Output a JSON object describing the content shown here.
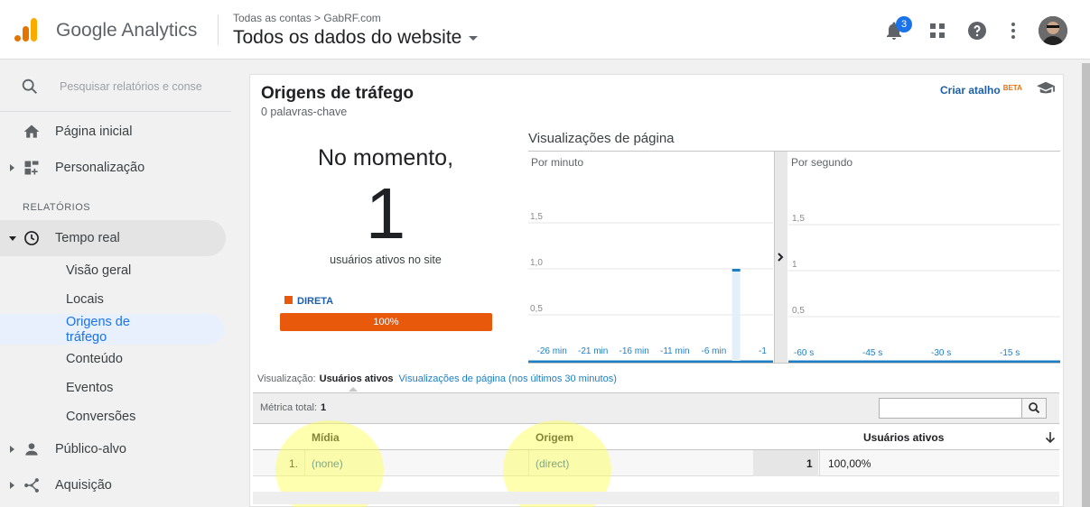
{
  "header": {
    "app_name": "Google Analytics",
    "breadcrumb": "Todas as contas > GabRF.com",
    "property": "Todos os dados do website",
    "notification_count": "3"
  },
  "sidebar": {
    "search_placeholder": "Pesquisar relatórios e conse",
    "home": "Página inicial",
    "customization": "Personalização",
    "section_reports": "RELATÓRIOS",
    "realtime": "Tempo real",
    "realtime_items": [
      "Visão geral",
      "Locais",
      "Origens de tráfego",
      "Conteúdo",
      "Eventos",
      "Conversões"
    ],
    "audience": "Público-alvo",
    "acquisition": "Aquisição"
  },
  "report": {
    "title": "Origens de tráfego",
    "subtitle": "0 palavras-chave",
    "shortcut": "Criar atalho",
    "beta": "BETA",
    "now_label": "No momento,",
    "active_count": "1",
    "active_label": "usuários ativos no site",
    "legend_label": "DIRETA",
    "legend_color": "#e8590c",
    "bar_label": "100%",
    "pageviews_title": "Visualizações de página",
    "view_label": "Visualização:",
    "view_selected": "Usuários ativos",
    "view_other": "Visualizações de página (nos últimos 30 minutos)",
    "metric_total_label": "Métrica total:",
    "metric_total_value": "1"
  },
  "chart_data": [
    {
      "type": "bar",
      "title": "Por minuto",
      "x_tick_labels": [
        "-26 min",
        "-21 min",
        "-16 min",
        "-11 min",
        "-6 min",
        "-1"
      ],
      "y_tick_labels": [
        "1,5",
        "1,0",
        "0,5"
      ],
      "ylim": [
        0,
        2
      ],
      "bars": [
        {
          "minute": -4,
          "value": 1
        }
      ]
    },
    {
      "type": "bar",
      "title": "Por segundo",
      "x_tick_labels": [
        "-60 s",
        "-45 s",
        "-30 s",
        "-15 s"
      ],
      "y_tick_labels": [
        "1,5",
        "1",
        "0,5"
      ],
      "ylim": [
        0,
        2
      ],
      "bars": []
    }
  ],
  "table": {
    "columns": [
      "Mídia",
      "Origem",
      "Usuários ativos"
    ],
    "rows": [
      {
        "index": "1.",
        "medium": "(none)",
        "source": "(direct)",
        "users": "1",
        "percent": "100,00%"
      }
    ]
  }
}
